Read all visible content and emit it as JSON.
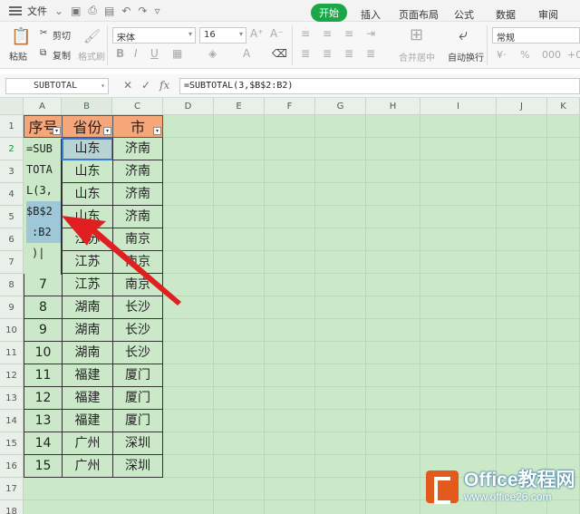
{
  "menubar": {
    "file_label": "文件",
    "tabs": [
      {
        "label": "开始",
        "active": true
      },
      {
        "label": "插入",
        "active": false
      },
      {
        "label": "页面布局",
        "active": false
      },
      {
        "label": "公式",
        "active": false
      },
      {
        "label": "数据",
        "active": false
      },
      {
        "label": "审阅",
        "active": false
      }
    ]
  },
  "ribbon": {
    "cut_label": "剪切",
    "copy_label": "复制",
    "paste_label": "粘贴",
    "format_painter_label": "格式刷",
    "font_name": "宋体",
    "font_size": "16",
    "merge_label": "合并居中",
    "wrap_label": "自动换行",
    "number_format": "常规"
  },
  "formula_bar": {
    "name_box": "SUBTOTAL",
    "formula": "=SUBTOTAL(3,$B$2:B2)"
  },
  "sheet": {
    "columns": [
      "A",
      "B",
      "C",
      "D",
      "E",
      "F",
      "G",
      "H",
      "I",
      "J",
      "K"
    ],
    "rows": [
      "1",
      "2",
      "3",
      "4",
      "5",
      "6",
      "7",
      "8",
      "9",
      "10",
      "11",
      "12",
      "13",
      "14",
      "15",
      "16",
      "17",
      "18"
    ],
    "headers": [
      "序号",
      "省份",
      "市"
    ],
    "data": [
      {
        "a": "",
        "b": "山东",
        "c": "济南"
      },
      {
        "a": "",
        "b": "山东",
        "c": "济南"
      },
      {
        "a": "",
        "b": "山东",
        "c": "济南"
      },
      {
        "a": "",
        "b": "山东",
        "c": "济南"
      },
      {
        "a": "",
        "b": "江苏",
        "c": "南京"
      },
      {
        "a": "",
        "b": "江苏",
        "c": "南京"
      },
      {
        "a": "7",
        "b": "江苏",
        "c": "南京"
      },
      {
        "a": "8",
        "b": "湖南",
        "c": "长沙"
      },
      {
        "a": "9",
        "b": "湖南",
        "c": "长沙"
      },
      {
        "a": "10",
        "b": "湖南",
        "c": "长沙"
      },
      {
        "a": "11",
        "b": "福建",
        "c": "厦门"
      },
      {
        "a": "12",
        "b": "福建",
        "c": "厦门"
      },
      {
        "a": "13",
        "b": "福建",
        "c": "厦门"
      },
      {
        "a": "14",
        "b": "广州",
        "c": "深圳"
      },
      {
        "a": "15",
        "b": "广州",
        "c": "深圳"
      }
    ],
    "editor_lines": [
      "=SUB",
      "TOTA",
      "L(3,",
      "$B$2",
      ":B2",
      ")|"
    ]
  },
  "watermark": {
    "brand": "Office教程网",
    "url": "www.office26.com"
  },
  "colors": {
    "accent": "#1ba748",
    "sheet_bg": "#cbe8c9",
    "header_fill": "#f5a77a",
    "arrow": "#e02020"
  }
}
